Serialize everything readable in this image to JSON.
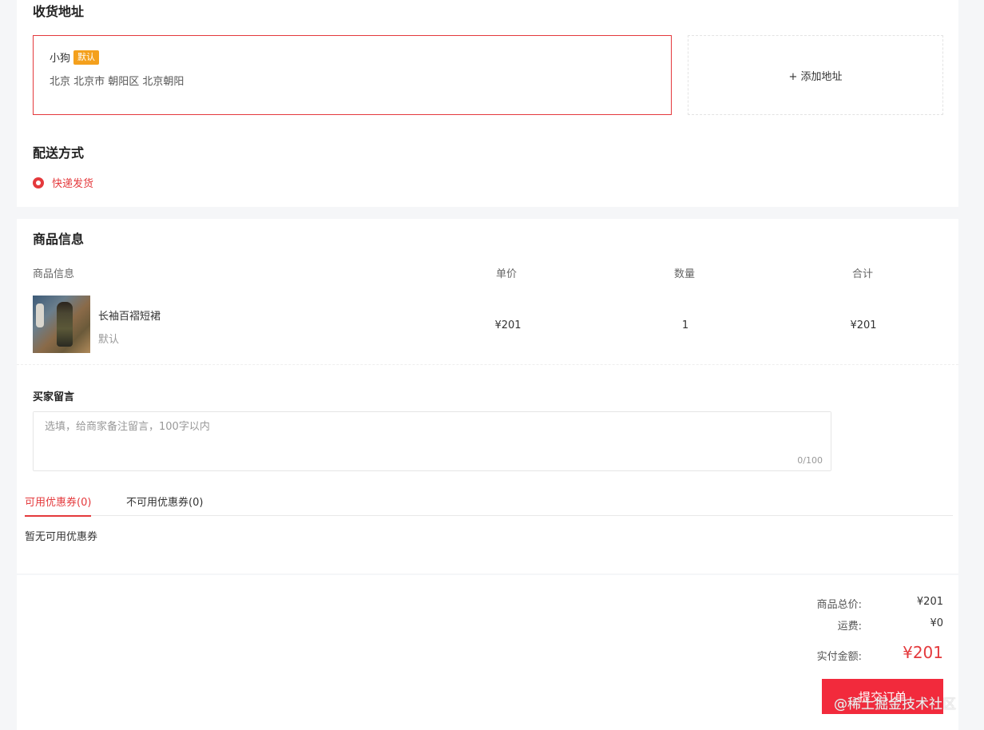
{
  "address": {
    "title": "收货地址",
    "card": {
      "name": "小狗",
      "badge": "默认",
      "detail": "北京 北京市 朝阳区 北京朝阳"
    },
    "add_label": "+ 添加地址"
  },
  "shipping": {
    "title": "配送方式",
    "option": "快递发货"
  },
  "goods": {
    "title": "商品信息",
    "columns": [
      "商品信息",
      "单价",
      "数量",
      "合计"
    ],
    "item": {
      "name": "长袖百褶短裙",
      "spec": "默认",
      "price": "¥201",
      "qty": "1",
      "subtotal": "¥201"
    }
  },
  "message": {
    "title": "买家留言",
    "placeholder": "选填，给商家备注留言，100字以内",
    "counter": "0/100"
  },
  "coupons": {
    "tab_available": "可用优惠券(0)",
    "tab_unavailable": "不可用优惠券(0)",
    "empty_text": "暂无可用优惠券"
  },
  "summary": {
    "goods_total_label": "商品总价:",
    "goods_total_value": "¥201",
    "shipping_label": "运费:",
    "shipping_value": "¥0",
    "pay_label": "实付金额:",
    "pay_value": "¥201",
    "submit_label": "提交订单"
  },
  "watermark": "@稀土掘金技术社区"
}
